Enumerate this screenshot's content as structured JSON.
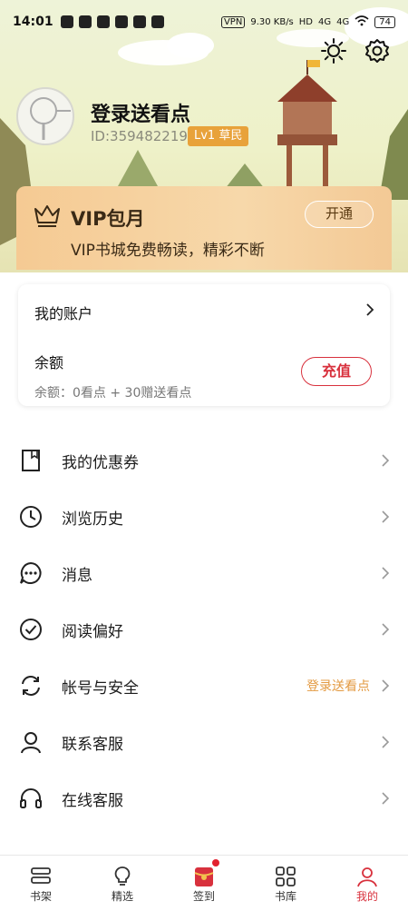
{
  "status_bar": {
    "time": "14:01",
    "net_speed": "9.30 KB/s",
    "vpn": "VPN",
    "battery": "74",
    "hd": "HD",
    "g1": "4G",
    "g2": "4G"
  },
  "header": {
    "icons": [
      "brightness-icon",
      "settings-gear-icon"
    ],
    "profile": {
      "nickname": "登录送看点",
      "user_id": "ID:359482219",
      "level": "Lv1 草民"
    }
  },
  "vip": {
    "title": "VIP包月",
    "subtitle": "VIP书城免费畅读，精彩不断",
    "button": "开通"
  },
  "account": {
    "title": "我的账户",
    "balance_title": "余额",
    "balance_detail": "余额：0看点 + 30赠送看点",
    "recharge_button": "充值"
  },
  "menu": [
    {
      "label": "我的优惠券",
      "icon": "coupon-icon"
    },
    {
      "label": "浏览历史",
      "icon": "clock-icon"
    },
    {
      "label": "消息",
      "icon": "message-icon"
    },
    {
      "label": "阅读偏好",
      "icon": "check-circle-icon"
    },
    {
      "label": "帐号与安全",
      "icon": "sync-icon",
      "extra": "登录送看点"
    },
    {
      "label": "联系客服",
      "icon": "person-icon"
    },
    {
      "label": "在线客服",
      "icon": "headset-icon"
    }
  ],
  "bottom_nav": [
    {
      "label": "书架",
      "icon": "bookshelf-icon"
    },
    {
      "label": "精选",
      "icon": "lightbulb-icon"
    },
    {
      "label": "签到",
      "icon": "red-envelope-icon"
    },
    {
      "label": "书库",
      "icon": "grid-icon"
    },
    {
      "label": "我的",
      "icon": "user-icon",
      "active": true
    }
  ],
  "colors": {
    "accent_red": "#d8313d",
    "vip_gold": "#f5ca93",
    "level_orange": "#e8a23a",
    "extra_orange": "#e39a42"
  }
}
